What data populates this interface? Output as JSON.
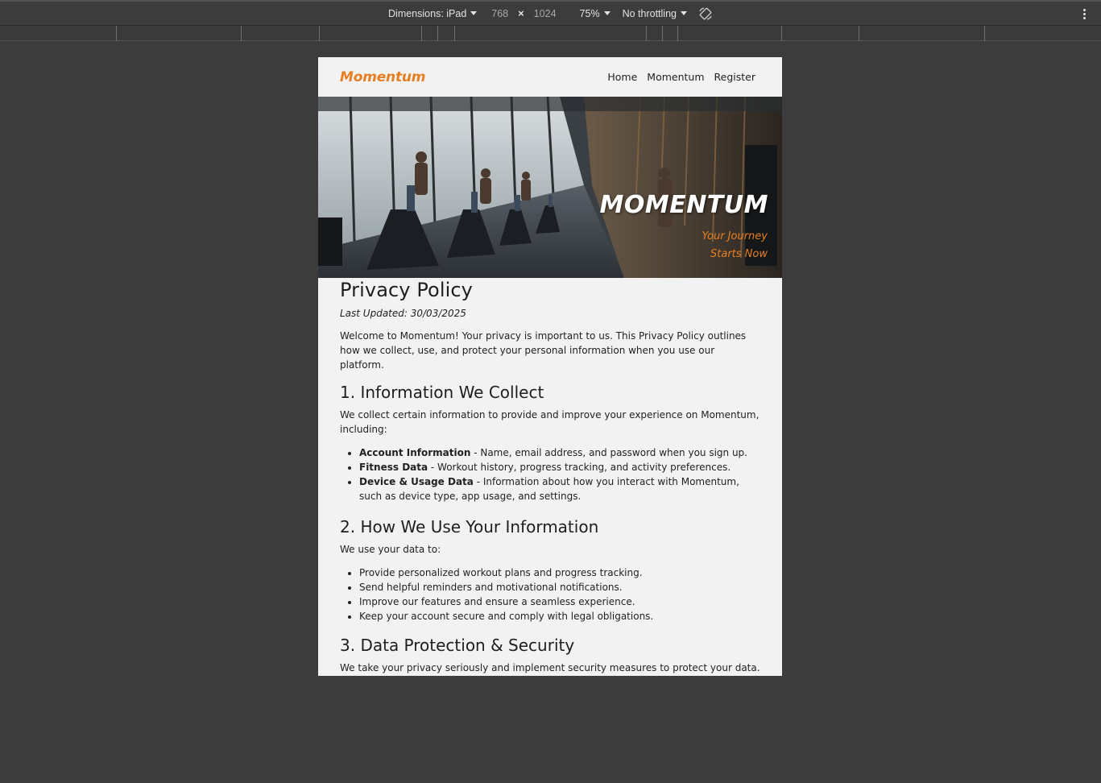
{
  "devtools": {
    "dimensions_label": "Dimensions: iPad",
    "width": "768",
    "height": "1024",
    "zoom": "75%",
    "throttling": "No throttling"
  },
  "site": {
    "logo": "Momentum",
    "nav": [
      "Home",
      "Momentum",
      "Register"
    ],
    "hero": {
      "title": "MOMENTUM",
      "tagline_line1": "Your Journey",
      "tagline_line2": "Starts Now"
    }
  },
  "policy": {
    "title": "Privacy Policy",
    "last_updated": "Last Updated: 30/03/2025",
    "intro": "Welcome to Momentum! Your privacy is important to us. This Privacy Policy outlines how we collect, use, and protect your personal information when you use our platform.",
    "sections": [
      {
        "heading": "1. Information We Collect",
        "text": "We collect certain information to provide and improve your experience on Momentum, including:",
        "items": [
          {
            "bold": "Account Information",
            "text": " - Name, email address, and password when you sign up."
          },
          {
            "bold": "Fitness Data",
            "text": " - Workout history, progress tracking, and activity preferences."
          },
          {
            "bold": "Device & Usage Data",
            "text": " - Information about how you interact with Momentum, such as device type, app usage, and settings."
          }
        ]
      },
      {
        "heading": "2. How We Use Your Information",
        "text": "We use your data to:",
        "items": [
          "Provide personalized workout plans and progress tracking.",
          "Send helpful reminders and motivational notifications.",
          "Improve our features and ensure a seamless experience.",
          "Keep your account secure and comply with legal obligations."
        ]
      },
      {
        "heading": "3. Data Protection & Security",
        "text": "We take your privacy seriously and implement security measures to protect your data. Your personal information is never sold or shared with third parties without your"
      }
    ]
  },
  "colors": {
    "accent": "#e67e22",
    "devtools_bg": "#3c3c3c",
    "page_bg": "#f2f2f2"
  }
}
